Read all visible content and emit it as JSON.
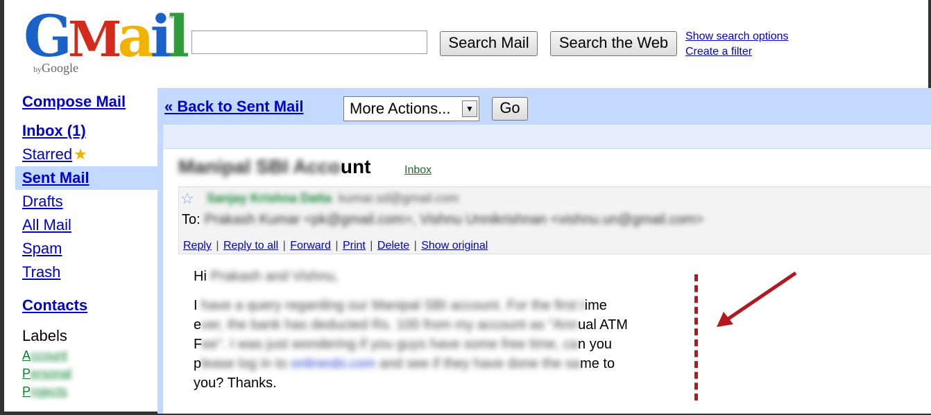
{
  "header": {
    "logo_by": "by",
    "logo_google": "Google",
    "logo_tm": "™",
    "search_value": "",
    "search_mail_label": "Search Mail",
    "search_web_label": "Search the Web",
    "show_search_options": "Show search options",
    "create_filter": "Create a filter"
  },
  "sidebar": {
    "compose": "Compose Mail",
    "items": [
      {
        "label": "Inbox (1)"
      },
      {
        "label": "Starred"
      },
      {
        "label": "Sent Mail"
      },
      {
        "label": "Drafts"
      },
      {
        "label": "All Mail"
      },
      {
        "label": "Spam"
      },
      {
        "label": "Trash"
      }
    ],
    "contacts": "Contacts",
    "labels_header": "Labels",
    "labels": [
      "A",
      "P",
      "P"
    ]
  },
  "toolbar": {
    "back_link": "« Back to Sent Mail",
    "more_actions": "More Actions...",
    "go_label": "Go"
  },
  "message": {
    "subject_visible": "unt",
    "inbox_tag": "Inbox",
    "to_label": "To:",
    "actions": [
      "Reply",
      "Reply to all",
      "Forward",
      "Print",
      "Delete",
      "Show original"
    ],
    "separator": "|",
    "body_greeting": "Hi",
    "body_lines_visible": [
      {
        "start": "I",
        "end": "ime"
      },
      {
        "start": "e",
        "end": "ual ATM"
      },
      {
        "start": "F",
        "end": "n you"
      },
      {
        "start": "p",
        "end": "me to"
      }
    ],
    "body_last_line": "you? Thanks."
  },
  "annotation": {
    "color": "#b3191c"
  }
}
